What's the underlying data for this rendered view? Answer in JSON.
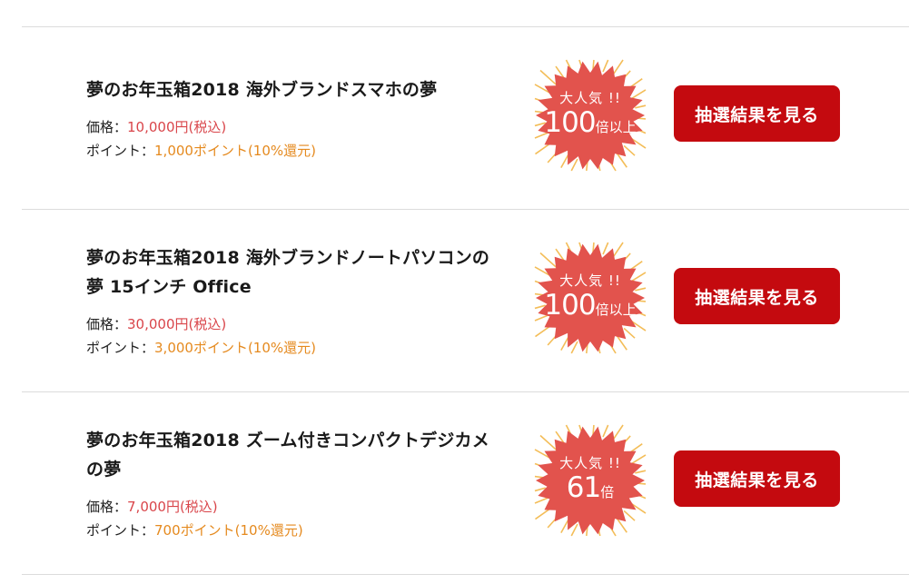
{
  "items": [
    {
      "title": "夢のお年玉箱2018 海外ブランドスマホの夢",
      "price_label": "価格：",
      "price_value": "10,000円(税込)",
      "point_label": "ポイント：",
      "point_value": "1,000ポイント(10%還元)",
      "badge_top": "大人気 !!",
      "badge_number": "100",
      "badge_suffix": "倍以上",
      "button_label": "抽選結果を見る"
    },
    {
      "title": "夢のお年玉箱2018 海外ブランドノートパソコンの夢 15インチ Office",
      "price_label": "価格：",
      "price_value": "30,000円(税込)",
      "point_label": "ポイント：",
      "point_value": "3,000ポイント(10%還元)",
      "badge_top": "大人気 !!",
      "badge_number": "100",
      "badge_suffix": "倍以上",
      "button_label": "抽選結果を見る"
    },
    {
      "title": "夢のお年玉箱2018 ズーム付きコンパクトデジカメの夢",
      "price_label": "価格：",
      "price_value": "7,000円(税込)",
      "point_label": "ポイント：",
      "point_value": "700ポイント(10%還元)",
      "badge_top": "大人気 !!",
      "badge_number": "61",
      "badge_suffix": "倍",
      "button_label": "抽選結果を見る"
    }
  ],
  "colors": {
    "price": "#d9454a",
    "point": "#e58a1f",
    "badge_fill": "#e2534d",
    "badge_rays": "#f2b23c",
    "button": "#c40a0f",
    "divider": "#dcdcdc"
  },
  "icons": {
    "badge_shape": "starburst-badge-icon"
  }
}
